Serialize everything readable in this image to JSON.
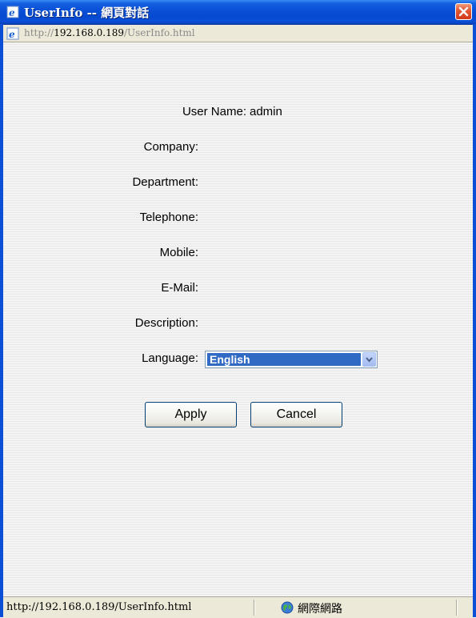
{
  "window": {
    "title": "UserInfo -- 網頁對話",
    "close_label": "Close"
  },
  "addressbar": {
    "url_scheme": "http://",
    "url_host": "192.168.0.189",
    "url_path": "/UserInfo.html"
  },
  "form": {
    "fields": [
      {
        "label": "User Name:",
        "value": "admin"
      },
      {
        "label": "Company:",
        "value": ""
      },
      {
        "label": "Department:",
        "value": ""
      },
      {
        "label": "Telephone:",
        "value": ""
      },
      {
        "label": "Mobile:",
        "value": ""
      },
      {
        "label": "E-Mail:",
        "value": ""
      },
      {
        "label": "Description:",
        "value": ""
      }
    ],
    "language": {
      "label": "Language:",
      "selected": "English"
    },
    "apply_label": "Apply",
    "cancel_label": "Cancel"
  },
  "statusbar": {
    "url": "http://192.168.0.189/UserInfo.html",
    "zone": "網際網路"
  },
  "colors": {
    "titlebar": "#0a52d8",
    "selection": "#316ac5",
    "close_button": "#e35a35"
  }
}
